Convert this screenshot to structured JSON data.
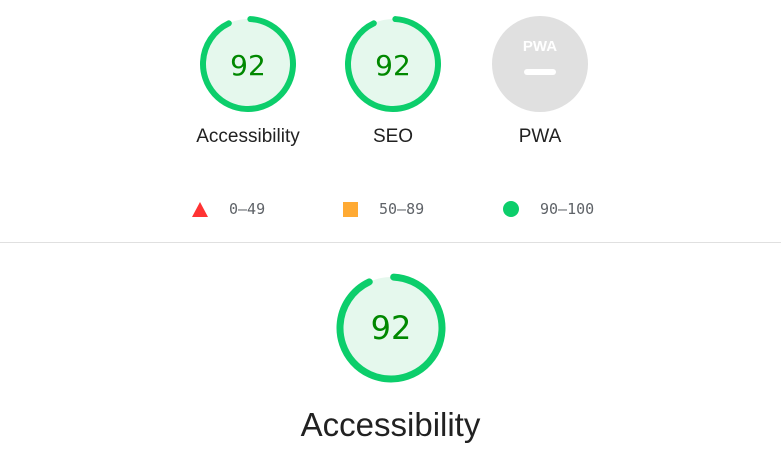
{
  "gauges": [
    {
      "score": "92",
      "label": "Accessibility",
      "fraction": 0.92
    },
    {
      "score": "92",
      "label": "SEO",
      "fraction": 0.92
    },
    {
      "badge": "PWA",
      "label": "PWA"
    }
  ],
  "legend": [
    {
      "range": "0–49",
      "shape": "triangle",
      "color": "#ff3333"
    },
    {
      "range": "50–89",
      "shape": "square",
      "color": "#ffaa33"
    },
    {
      "range": "90–100",
      "shape": "circle",
      "color": "#0cce6b"
    }
  ],
  "detail": {
    "score": "92",
    "label": "Accessibility",
    "fraction": 0.92
  },
  "colors": {
    "pass": "#0cce6b",
    "pass_fill": "#e5f8ed",
    "pass_text": "#008800",
    "neutral_fill": "#e0e0e0",
    "neutral_mark": "#ffffff"
  }
}
